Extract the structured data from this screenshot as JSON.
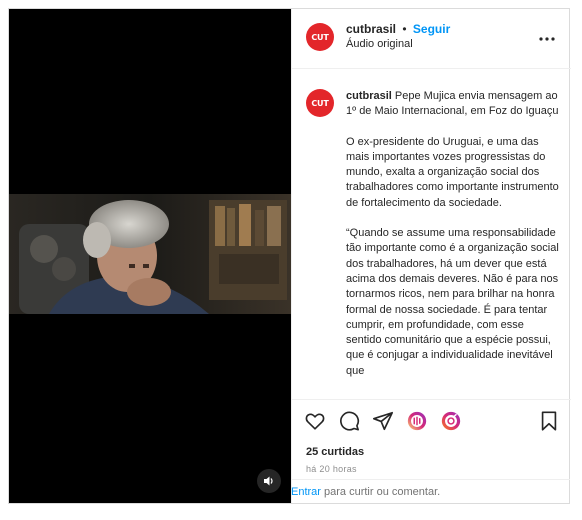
{
  "header": {
    "avatar_text": "CUT",
    "username": "cutbrasil",
    "separator": "•",
    "follow_label": "Seguir",
    "subtitle": "Áudio original",
    "more_icon": "more-horizontal-icon"
  },
  "caption": {
    "avatar_text": "CUT",
    "username": "cutbrasil",
    "headline": "Pepe Mujica envia mensagem ao 1º de Maio Internacional, em Foz do Iguaçu",
    "paragraph1": "O ex-presidente do Uruguai, e uma das mais importantes vozes progressistas do mundo, exalta a organização social dos trabalhadores como importante instrumento de fortalecimento da sociedade.",
    "paragraph2": "“Quando se assume uma responsabilidade tão importante como é a organização social dos trabalhadores, há um dever que está acima dos demais deveres. Não é para nos tornarmos ricos, nem para brilhar na honra formal de nossa sociedade. É para tentar cumprir, em profundidade, com esse sentido comunitário que a espécie possui, que é conjugar a individualidade inevitável que"
  },
  "actions": {
    "icons": [
      "heart-icon",
      "comment-icon",
      "share-icon",
      "emoji-reaction-icon",
      "emoji-reaction-icon",
      "bookmark-icon"
    ],
    "likes": "25 curtidas",
    "time": "há 20 horas"
  },
  "comment": {
    "enter_label": "Entrar",
    "rest": " para curtir ou comentar."
  },
  "media": {
    "audio_icon": "volume-icon"
  },
  "colors": {
    "brand": "#e3262a",
    "link": "#0095f6",
    "muted": "#8e8e8e"
  }
}
